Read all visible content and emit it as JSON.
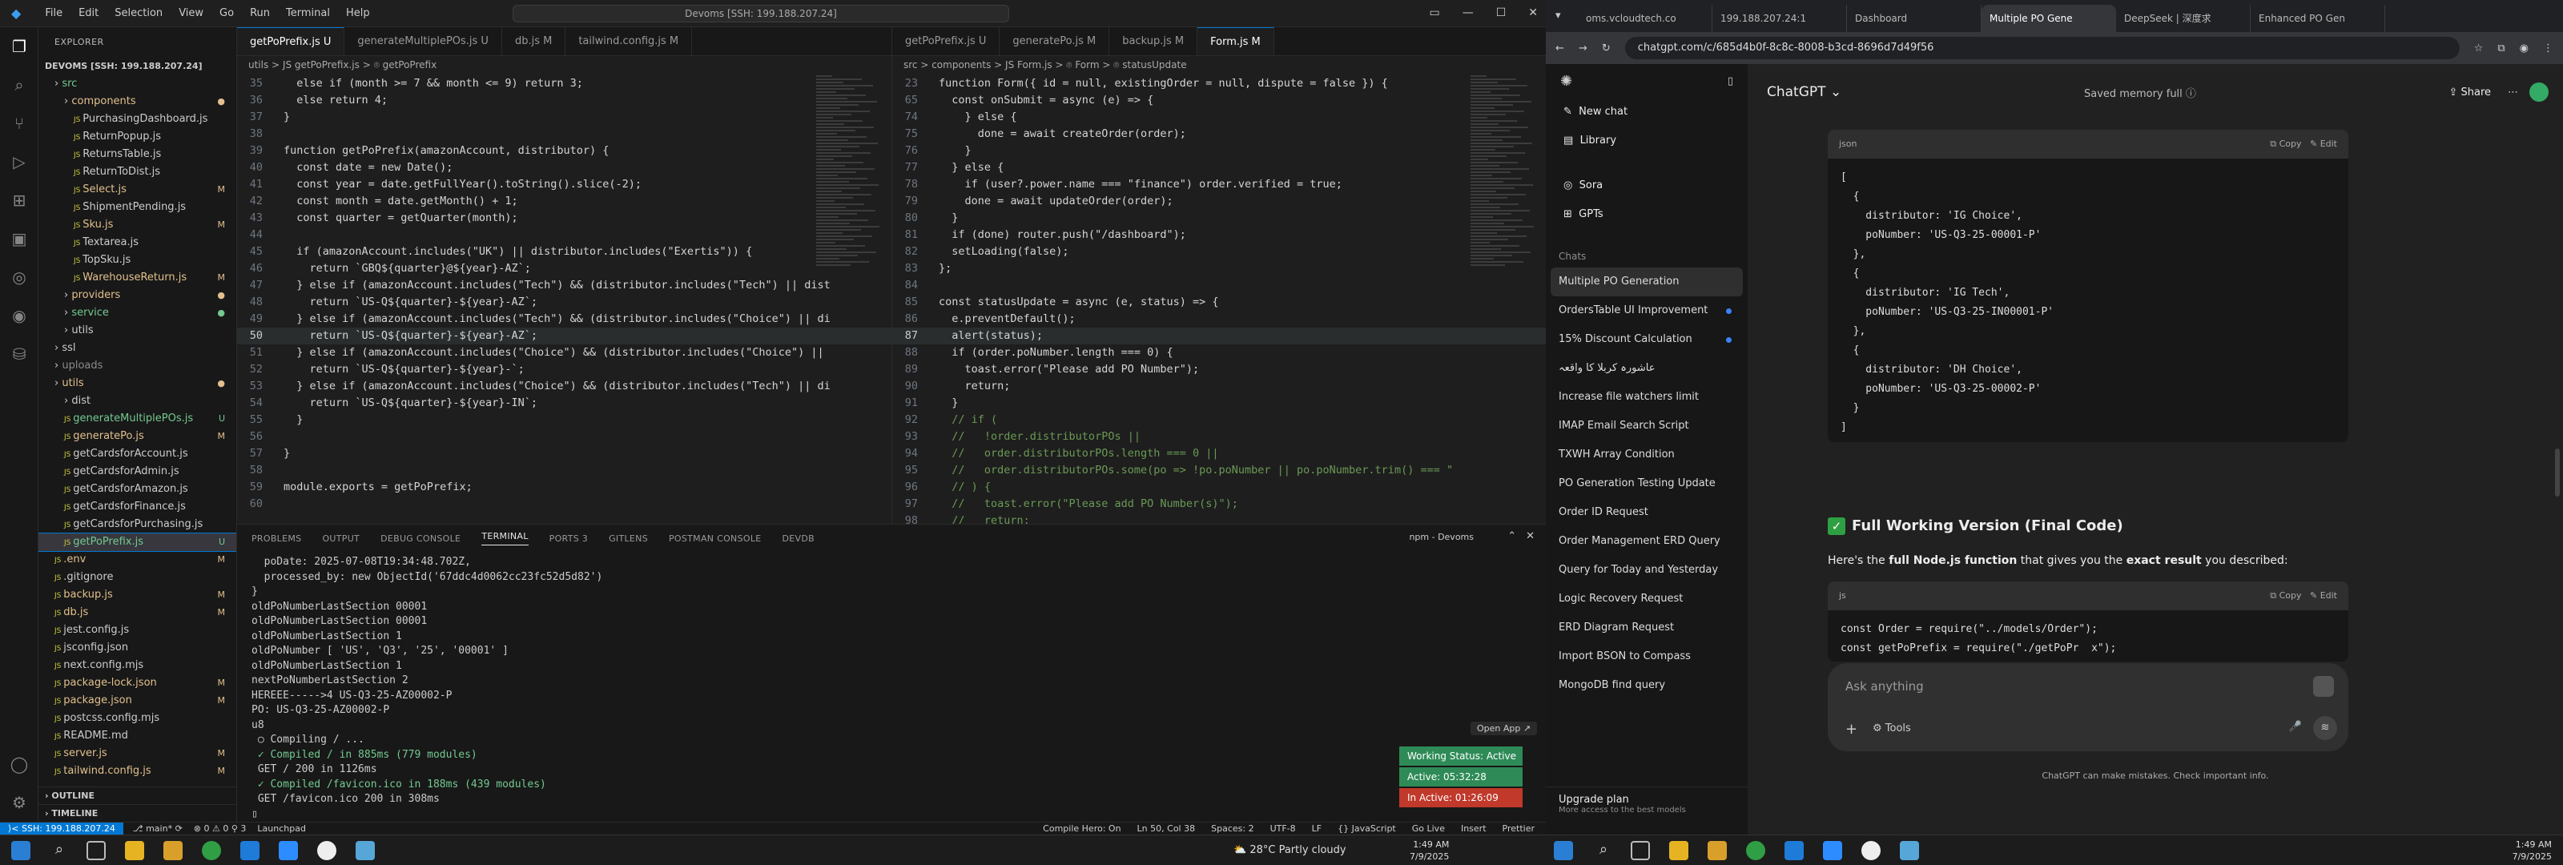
{
  "vscode": {
    "menu": [
      "File",
      "Edit",
      "Selection",
      "View",
      "Go",
      "Run",
      "Terminal",
      "Help"
    ],
    "command_center": "Devoms [SSH: 199.188.207.24]",
    "explorer_title": "EXPLORER",
    "root": "DEVOMS [SSH: 199.188.207.24]",
    "tree": [
      {
        "label": "src",
        "indent": 1,
        "kind": "folder",
        "status": "",
        "cls": "c-unt"
      },
      {
        "label": "components",
        "indent": 2,
        "kind": "folder",
        "status": "●",
        "cls": "c-mod"
      },
      {
        "label": "PurchasingDashboard.js",
        "indent": 3,
        "kind": "file",
        "status": "",
        "cls": ""
      },
      {
        "label": "ReturnPopup.js",
        "indent": 3,
        "kind": "file",
        "status": "",
        "cls": ""
      },
      {
        "label": "ReturnsTable.js",
        "indent": 3,
        "kind": "file",
        "status": "",
        "cls": ""
      },
      {
        "label": "ReturnToDist.js",
        "indent": 3,
        "kind": "file",
        "status": "",
        "cls": ""
      },
      {
        "label": "Select.js",
        "indent": 3,
        "kind": "file",
        "status": "M",
        "cls": "c-mod"
      },
      {
        "label": "ShipmentPending.js",
        "indent": 3,
        "kind": "file",
        "status": "",
        "cls": ""
      },
      {
        "label": "Sku.js",
        "indent": 3,
        "kind": "file",
        "status": "M",
        "cls": "c-mod"
      },
      {
        "label": "Textarea.js",
        "indent": 3,
        "kind": "file",
        "status": "",
        "cls": ""
      },
      {
        "label": "TopSku.js",
        "indent": 3,
        "kind": "file",
        "status": "",
        "cls": ""
      },
      {
        "label": "WarehouseReturn.js",
        "indent": 3,
        "kind": "file",
        "status": "M",
        "cls": "c-mod"
      },
      {
        "label": "providers",
        "indent": 2,
        "kind": "folder",
        "status": "●",
        "cls": "c-mod"
      },
      {
        "label": "service",
        "indent": 2,
        "kind": "folder",
        "status": "●",
        "cls": "c-unt"
      },
      {
        "label": "utils",
        "indent": 2,
        "kind": "folder",
        "status": "",
        "cls": ""
      },
      {
        "label": "ssl",
        "indent": 1,
        "kind": "folder",
        "status": "",
        "cls": ""
      },
      {
        "label": "uploads",
        "indent": 1,
        "kind": "folder",
        "status": "",
        "cls": "c-dim"
      },
      {
        "label": "utils",
        "indent": 1,
        "kind": "folder",
        "status": "●",
        "cls": "c-mod"
      },
      {
        "label": "dist",
        "indent": 2,
        "kind": "folder",
        "status": "",
        "cls": ""
      },
      {
        "label": "generateMultiplePOs.js",
        "indent": 2,
        "kind": "file",
        "status": "U",
        "cls": "c-unt"
      },
      {
        "label": "generatePo.js",
        "indent": 2,
        "kind": "file",
        "status": "M",
        "cls": "c-mod"
      },
      {
        "label": "getCardsforAccount.js",
        "indent": 2,
        "kind": "file",
        "status": "",
        "cls": ""
      },
      {
        "label": "getCardsforAdmin.js",
        "indent": 2,
        "kind": "file",
        "status": "",
        "cls": ""
      },
      {
        "label": "getCardsforAmazon.js",
        "indent": 2,
        "kind": "file",
        "status": "",
        "cls": ""
      },
      {
        "label": "getCardsforFinance.js",
        "indent": 2,
        "kind": "file",
        "status": "",
        "cls": ""
      },
      {
        "label": "getCardsforPurchasing.js",
        "indent": 2,
        "kind": "file",
        "status": "",
        "cls": ""
      },
      {
        "label": "getPoPrefix.js",
        "indent": 2,
        "kind": "file",
        "status": "U",
        "cls": "c-unt",
        "selected": true
      },
      {
        "label": ".env",
        "indent": 1,
        "kind": "file",
        "status": "M",
        "cls": "c-mod"
      },
      {
        "label": ".gitignore",
        "indent": 1,
        "kind": "file",
        "status": "",
        "cls": ""
      },
      {
        "label": "backup.js",
        "indent": 1,
        "kind": "file",
        "status": "M",
        "cls": "c-mod"
      },
      {
        "label": "db.js",
        "indent": 1,
        "kind": "file",
        "status": "M",
        "cls": "c-mod"
      },
      {
        "label": "jest.config.js",
        "indent": 1,
        "kind": "file",
        "status": "",
        "cls": ""
      },
      {
        "label": "jsconfig.json",
        "indent": 1,
        "kind": "file",
        "status": "",
        "cls": ""
      },
      {
        "label": "next.config.mjs",
        "indent": 1,
        "kind": "file",
        "status": "",
        "cls": ""
      },
      {
        "label": "package-lock.json",
        "indent": 1,
        "kind": "file",
        "status": "M",
        "cls": "c-mod"
      },
      {
        "label": "package.json",
        "indent": 1,
        "kind": "file",
        "status": "M",
        "cls": "c-mod"
      },
      {
        "label": "postcss.config.mjs",
        "indent": 1,
        "kind": "file",
        "status": "",
        "cls": ""
      },
      {
        "label": "README.md",
        "indent": 1,
        "kind": "file",
        "status": "",
        "cls": ""
      },
      {
        "label": "server.js",
        "indent": 1,
        "kind": "file",
        "status": "M",
        "cls": "c-mod"
      },
      {
        "label": "tailwind.config.js",
        "indent": 1,
        "kind": "file",
        "status": "M",
        "cls": "c-mod"
      }
    ],
    "outline": "OUTLINE",
    "timeline": "TIMELINE",
    "left_editor": {
      "tabs": [
        {
          "label": "getPoPrefix.js  U",
          "active": true
        },
        {
          "label": "generateMultiplePOs.js  U",
          "active": false
        },
        {
          "label": "db.js  M",
          "active": false
        },
        {
          "label": "tailwind.config.js  M",
          "active": false
        }
      ],
      "breadcrumb": "utils > JS getPoPrefix.js > ⌾ getPoPrefix",
      "lines": [
        {
          "n": "35",
          "t": "  else if (month >= 7 && month <= 9) return 3;"
        },
        {
          "n": "36",
          "t": "  else return 4;"
        },
        {
          "n": "37",
          "t": "}"
        },
        {
          "n": "38",
          "t": ""
        },
        {
          "n": "39",
          "t": "function getPoPrefix(amazonAccount, distributor) {"
        },
        {
          "n": "40",
          "t": "  const date = new Date();"
        },
        {
          "n": "41",
          "t": "  const year = date.getFullYear().toString().slice(-2);"
        },
        {
          "n": "42",
          "t": "  const month = date.getMonth() + 1;"
        },
        {
          "n": "43",
          "t": "  const quarter = getQuarter(month);"
        },
        {
          "n": "44",
          "t": ""
        },
        {
          "n": "45",
          "t": "  if (amazonAccount.includes(\"UK\") || distributor.includes(\"Exertis\")) {"
        },
        {
          "n": "46",
          "t": "    return `GBQ${quarter}@${year}-AZ`;"
        },
        {
          "n": "47",
          "t": "  } else if (amazonAccount.includes(\"Tech\") && (distributor.includes(\"Tech\") || dist"
        },
        {
          "n": "48",
          "t": "    return `US-Q${quarter}-${year}-AZ`;"
        },
        {
          "n": "49",
          "t": "  } else if (amazonAccount.includes(\"Tech\") && (distributor.includes(\"Choice\") || di"
        },
        {
          "n": "50",
          "t": "    return `US-Q${quarter}-${year}-AZ`;",
          "cur": true
        },
        {
          "n": "51",
          "t": "  } else if (amazonAccount.includes(\"Choice\") && (distributor.includes(\"Choice\") ||"
        },
        {
          "n": "52",
          "t": "    return `US-Q${quarter}-${year}-`;"
        },
        {
          "n": "53",
          "t": "  } else if (amazonAccount.includes(\"Choice\") && (distributor.includes(\"Tech\") || di"
        },
        {
          "n": "54",
          "t": "    return `US-Q${quarter}-${year}-IN`;"
        },
        {
          "n": "55",
          "t": "  }"
        },
        {
          "n": "56",
          "t": ""
        },
        {
          "n": "57",
          "t": "}"
        },
        {
          "n": "58",
          "t": ""
        },
        {
          "n": "59",
          "t": "module.exports = getPoPrefix;"
        },
        {
          "n": "60",
          "t": ""
        }
      ]
    },
    "right_editor": {
      "tabs": [
        {
          "label": "getPoPrefix.js  U",
          "active": false
        },
        {
          "label": "generatePo.js  M",
          "active": false
        },
        {
          "label": "backup.js  M",
          "active": false
        },
        {
          "label": "Form.js  M",
          "active": true
        }
      ],
      "breadcrumb": "src > components > JS Form.js > ⌾ Form > ⌾ statusUpdate",
      "lines": [
        {
          "n": "23",
          "t": "function Form({ id = null, existingOrder = null, dispute = false }) {"
        },
        {
          "n": "65",
          "t": "  const onSubmit = async (e) => {"
        },
        {
          "n": "74",
          "t": "    } else {"
        },
        {
          "n": "75",
          "t": "      done = await createOrder(order);"
        },
        {
          "n": "76",
          "t": "    }"
        },
        {
          "n": "77",
          "t": "  } else {"
        },
        {
          "n": "78",
          "t": "    if (user?.power.name === \"finance\") order.verified = true;"
        },
        {
          "n": "79",
          "t": "    done = await updateOrder(order);"
        },
        {
          "n": "80",
          "t": "  }"
        },
        {
          "n": "81",
          "t": "  if (done) router.push(\"/dashboard\");"
        },
        {
          "n": "82",
          "t": "  setLoading(false);"
        },
        {
          "n": "83",
          "t": "};"
        },
        {
          "n": "84",
          "t": ""
        },
        {
          "n": "85",
          "t": "const statusUpdate = async (e, status) => {"
        },
        {
          "n": "86",
          "t": "  e.preventDefault();"
        },
        {
          "n": "87",
          "t": "  alert(status);",
          "cur": true
        },
        {
          "n": "88",
          "t": "  if (order.poNumber.length === 0) {"
        },
        {
          "n": "89",
          "t": "    toast.error(\"Please add PO Number\");"
        },
        {
          "n": "90",
          "t": "    return;"
        },
        {
          "n": "91",
          "t": "  }"
        },
        {
          "n": "92",
          "t": "  // if ("
        },
        {
          "n": "93",
          "t": "  //   !order.distributorPOs ||"
        },
        {
          "n": "94",
          "t": "  //   order.distributorPOs.length === 0 ||"
        },
        {
          "n": "95",
          "t": "  //   order.distributorPOs.some(po => !po.poNumber || po.poNumber.trim() === \""
        },
        {
          "n": "96",
          "t": "  // ) {"
        },
        {
          "n": "97",
          "t": "  //   toast.error(\"Please add PO Number(s)\");"
        },
        {
          "n": "98",
          "t": "  //   return;"
        },
        {
          "n": "99",
          "t": "  // }"
        },
        {
          "n": "100",
          "t": ""
        }
      ]
    },
    "panel_tabs": [
      "PROBLEMS",
      "OUTPUT",
      "DEBUG CONSOLE",
      "TERMINAL",
      "PORTS  3",
      "GITLENS",
      "POSTMAN CONSOLE",
      "DEVDB"
    ],
    "terminal_label": "npm - Devoms",
    "terminal_lines": [
      "  poDate: 2025-07-08T19:34:48.702Z,",
      "  processed_by: new ObjectId('67ddc4d0062cc23fc52d5d82')",
      "}",
      "oldPoNumberLastSection 00001",
      "oldPoNumberLastSection 00001",
      "oldPoNumberLastSection 1",
      "oldPoNumber [ 'US', 'Q3', '25', '00001' ]",
      "oldPoNumberLastSection 1",
      "nextPoNumberLastSection 2",
      "HEREEE----->4 US-Q3-25-AZ00002-P",
      "PO: US-Q3-25-AZ00002-P",
      "u8",
      " ○ Compiling / ...",
      " ✓ Compiled / in 885ms (779 modules)",
      " GET / 200 in 1126ms",
      " ✓ Compiled /favicon.ico in 188ms (439 modules)",
      " GET /favicon.ico 200 in 308ms",
      "▯"
    ],
    "open_app": "Open App ↗",
    "toasts": [
      {
        "label": "Working Status: Active",
        "color": "#2e8b57"
      },
      {
        "label": "Active: 05:32:28",
        "color": "#2e8b57"
      },
      {
        "label": "In Active: 01:26:09",
        "color": "#c0392b"
      }
    ],
    "status": {
      "remote": "⟩< SSH: 199.188.207.24",
      "branch": "⎇ main*  ⟳",
      "errors": "⊗ 0 ⚠ 0 ⚲ 3",
      "launch": "Launchpad",
      "right": [
        "Compile Hero: On",
        "Ln 50, Col 38",
        "Spaces: 2",
        "UTF-8",
        "LF",
        "{} JavaScript",
        "Go Live",
        "Insert",
        "Prettier"
      ]
    }
  },
  "chrome": {
    "tabs": [
      {
        "label": "oms.vcloudtech.co",
        "active": false
      },
      {
        "label": "199.188.207.24:1",
        "active": false
      },
      {
        "label": "Dashboard",
        "active": false
      },
      {
        "label": "Multiple PO Gene",
        "active": true
      },
      {
        "label": "DeepSeek | 深度求",
        "active": false
      },
      {
        "label": "Enhanced PO Gen",
        "active": false
      }
    ],
    "url": "chatgpt.com/c/685d4b0f-8c8c-8008-b3cd-8696d7d49f56"
  },
  "chatgpt": {
    "new_chat": "New chat",
    "library": "Library",
    "sora": "Sora",
    "gpts": "GPTs",
    "chats_label": "Chats",
    "chats": [
      {
        "label": "Multiple PO Generation",
        "selected": true,
        "dot": false
      },
      {
        "label": "OrdersTable UI Improvement",
        "selected": false,
        "dot": true
      },
      {
        "label": "15% Discount Calculation",
        "selected": false,
        "dot": true
      },
      {
        "label": "عاشورہ کربلا کا واقعہ",
        "selected": false,
        "dot": false
      },
      {
        "label": "Increase file watchers limit",
        "selected": false,
        "dot": false
      },
      {
        "label": "IMAP Email Search Script",
        "selected": false,
        "dot": false
      },
      {
        "label": "TXWH Array Condition",
        "selected": false,
        "dot": false
      },
      {
        "label": "PO Generation Testing Update",
        "selected": false,
        "dot": false
      },
      {
        "label": "Order ID Request",
        "selected": false,
        "dot": false
      },
      {
        "label": "Order Management ERD Query",
        "selected": false,
        "dot": false
      },
      {
        "label": "Query for Today and Yesterday",
        "selected": false,
        "dot": false
      },
      {
        "label": "Logic Recovery Request",
        "selected": false,
        "dot": false
      },
      {
        "label": "ERD Diagram Request",
        "selected": false,
        "dot": false
      },
      {
        "label": "Import BSON to Compass",
        "selected": false,
        "dot": false
      },
      {
        "label": "MongoDB find query",
        "selected": false,
        "dot": false
      }
    ],
    "upgrade": "Upgrade plan",
    "upgrade_sub": "More access to the best models",
    "model": "ChatGPT ⌄",
    "memory": "Saved memory full ⓘ",
    "share": "Share",
    "code1_lang": "json",
    "copy": "Copy",
    "edit": "Edit",
    "code1": "[\n  {\n    distributor: 'IG Choice',\n    poNumber: 'US-Q3-25-00001-P'\n  },\n  {\n    distributor: 'IG Tech',\n    poNumber: 'US-Q3-25-IN00001-P'\n  },\n  {\n    distributor: 'DH Choice',\n    poNumber: 'US-Q3-25-00002-P'\n  }\n]",
    "heading": "Full Working Version (Final Code)",
    "para_pre": "Here's the ",
    "para_b1": "full Node.js function",
    "para_mid": " that gives you the ",
    "para_b2": "exact result",
    "para_post": " you described:",
    "code2_lang": "js",
    "code2": "const Order = require(\"../models/Order\");\nconst getPoPrefix = require(\"./getPoPr  x\");",
    "ask_placeholder": "Ask anything",
    "tools": "Tools",
    "disclaimer": "ChatGPT can make mistakes. Check important info.",
    "colors": {
      "green_check": "#2ea043"
    }
  },
  "taskbar": {
    "weather": "28°C  Partly cloudy",
    "time": "1:49 AM",
    "date": "7/9/2025"
  },
  "chrome_taskbar": {
    "time": "1:49 AM",
    "date": "7/9/2025"
  }
}
